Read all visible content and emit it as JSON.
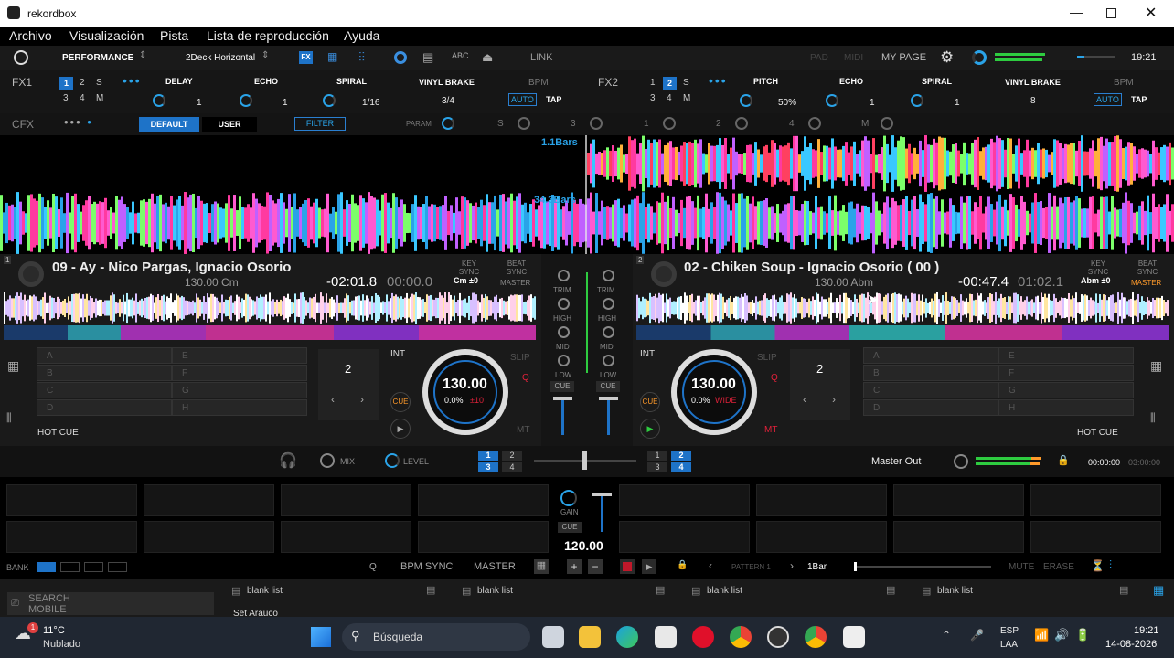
{
  "app": {
    "title": "rekordbox"
  },
  "menu": [
    "Archivo",
    "Visualización",
    "Pista",
    "Lista de reproducción",
    "Ayuda"
  ],
  "topbar": {
    "mode": "PERFORMANCE",
    "layout": "2Deck Horizontal",
    "link": "LINK",
    "pad": "PAD",
    "midi": "MIDI",
    "mypage": "MY PAGE",
    "clock": "19:21"
  },
  "fx1": {
    "label": "FX1",
    "decks": [
      "1",
      "2",
      "S",
      "3",
      "4",
      "M"
    ],
    "effects": [
      "DELAY",
      "ECHO",
      "SPIRAL"
    ],
    "effect_values": [
      "1",
      "1",
      "1/16"
    ],
    "brake": "VINYL BRAKE",
    "brake_value": "3/4",
    "bpm": "BPM",
    "auto": "AUTO",
    "tap": "TAP"
  },
  "fx2": {
    "label": "FX2",
    "decks": [
      "1",
      "2",
      "S",
      "3",
      "4",
      "M"
    ],
    "effects": [
      "PITCH",
      "ECHO",
      "SPIRAL"
    ],
    "effect_values": [
      "50%",
      "1",
      "1"
    ],
    "brake": "VINYL BRAKE",
    "brake_value": "8",
    "bpm": "BPM",
    "auto": "AUTO",
    "tap": "TAP"
  },
  "cfx": {
    "label": "CFX",
    "default": "DEFAULT",
    "user": "USER",
    "filter": "FILTER",
    "param": "PARAM",
    "s": "S",
    "nums": [
      "3",
      "1",
      "2",
      "4",
      "M"
    ]
  },
  "wave": {
    "bars_top": "1.1Bars",
    "bars_bottom": "34.3Bars"
  },
  "deck1": {
    "num": "1",
    "title": "09 - Ay - Nico Pargas, Ignacio Osorio",
    "bpm_key": "130.00 Cm",
    "remaining": "-02:01.8",
    "elapsed": "00:00.0",
    "key_sync": "KEY SYNC",
    "key_val": "Cm ±0",
    "beat_sync": "BEAT SYNC",
    "master": "MASTER",
    "slots": [
      "A",
      "B",
      "C",
      "D",
      "E",
      "F",
      "G",
      "H"
    ],
    "beat_num": "2",
    "int": "INT",
    "slip": "SLIP",
    "q": "Q",
    "mt": "MT",
    "cue": "CUE",
    "bpm": "130.00",
    "pitch": "0.0%",
    "range": "±10",
    "hotcue": "HOT CUE"
  },
  "deck2": {
    "num": "2",
    "title": "02 - Chiken Soup - Ignacio Osorio ( 00 )",
    "bpm_key": "130.00 Abm",
    "remaining": "-00:47.4",
    "elapsed": "01:02.1",
    "key_sync": "KEY SYNC",
    "key_val": "Abm ±0",
    "beat_sync": "BEAT SYNC",
    "master": "MASTER",
    "slots": [
      "A",
      "B",
      "C",
      "D",
      "E",
      "F",
      "G",
      "H"
    ],
    "beat_num": "2",
    "int": "INT",
    "slip": "SLIP",
    "q": "Q",
    "mt": "MT",
    "cue": "CUE",
    "bpm": "130.00",
    "pitch": "0.0%",
    "range": "WIDE",
    "hotcue": "HOT CUE"
  },
  "mixer": {
    "trim": "TRIM",
    "high": "HIGH",
    "mid": "MID",
    "low": "LOW",
    "cue": "CUE"
  },
  "masterrow": {
    "mix": "MIX",
    "level": "LEVEL",
    "master_out": "Master Out",
    "time1": "00:00:00",
    "time2": "03:00:00",
    "ch": [
      "1",
      "2",
      "3",
      "4"
    ]
  },
  "sampler": {
    "gain": "GAIN",
    "cue": "CUE",
    "bpm": "120.00",
    "bank": "BANK",
    "q": "Q",
    "bpm_sync": "BPM SYNC",
    "master": "MASTER",
    "pattern": "PATTERN 1",
    "bar": "1Bar",
    "mute": "MUTE",
    "erase": "ERASE"
  },
  "browser": {
    "search_mobile": "SEARCH MOBILE",
    "lists": [
      "blank list",
      "blank list",
      "blank list",
      "blank list"
    ],
    "playlist": "Set Arauco"
  },
  "taskbar": {
    "temp": "11°C",
    "weather": "Nublado",
    "search": "Búsqueda",
    "lang1": "ESP",
    "lang2": "LAA",
    "time": "19:21",
    "date": "14-08-2026",
    "badge": "1"
  },
  "colors": {
    "accent": "#1e73c8",
    "waveform_blue": "#2aa3e8",
    "master_orange": "#ff9a2a",
    "play_green": "#2ecc40",
    "red": "#e0213a"
  }
}
